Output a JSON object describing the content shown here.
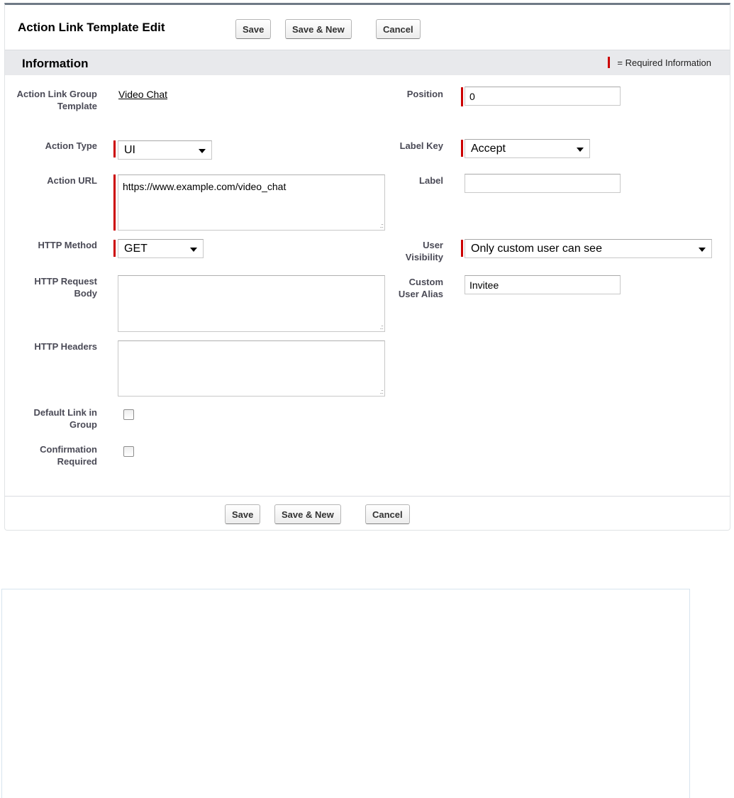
{
  "page": {
    "title": "Action Link Template Edit",
    "buttons": {
      "save": "Save",
      "save_new": "Save & New",
      "cancel": "Cancel"
    }
  },
  "section": {
    "title": "Information",
    "required_legend": "= Required Information"
  },
  "fields": {
    "group_template": {
      "label": "Action Link Group Template",
      "value": "Video Chat"
    },
    "position": {
      "label": "Position",
      "value": "0"
    },
    "action_type": {
      "label": "Action Type",
      "value": "UI"
    },
    "label_key": {
      "label": "Label Key",
      "value": "Accept"
    },
    "action_url": {
      "label": "Action URL",
      "value": "https://www.example.com/video_chat"
    },
    "label": {
      "label": "Label",
      "value": ""
    },
    "http_method": {
      "label": "HTTP Method",
      "value": "GET"
    },
    "user_visibility": {
      "label": "User Visibility",
      "value": "Only custom user can see"
    },
    "http_request_body": {
      "label": "HTTP Request Body",
      "value": ""
    },
    "custom_user_alias": {
      "label": "Custom User Alias",
      "value": "Invitee"
    },
    "http_headers": {
      "label": "HTTP Headers",
      "value": ""
    },
    "default_link": {
      "label": "Default Link in Group",
      "checked": false
    },
    "confirmation_required": {
      "label": "Confirmation Required",
      "checked": false
    }
  },
  "colors": {
    "required": "#cc0000",
    "section_bg": "#e8e9ec",
    "panel_top_border": "#6f7a86",
    "label_text": "#4a4a56"
  }
}
